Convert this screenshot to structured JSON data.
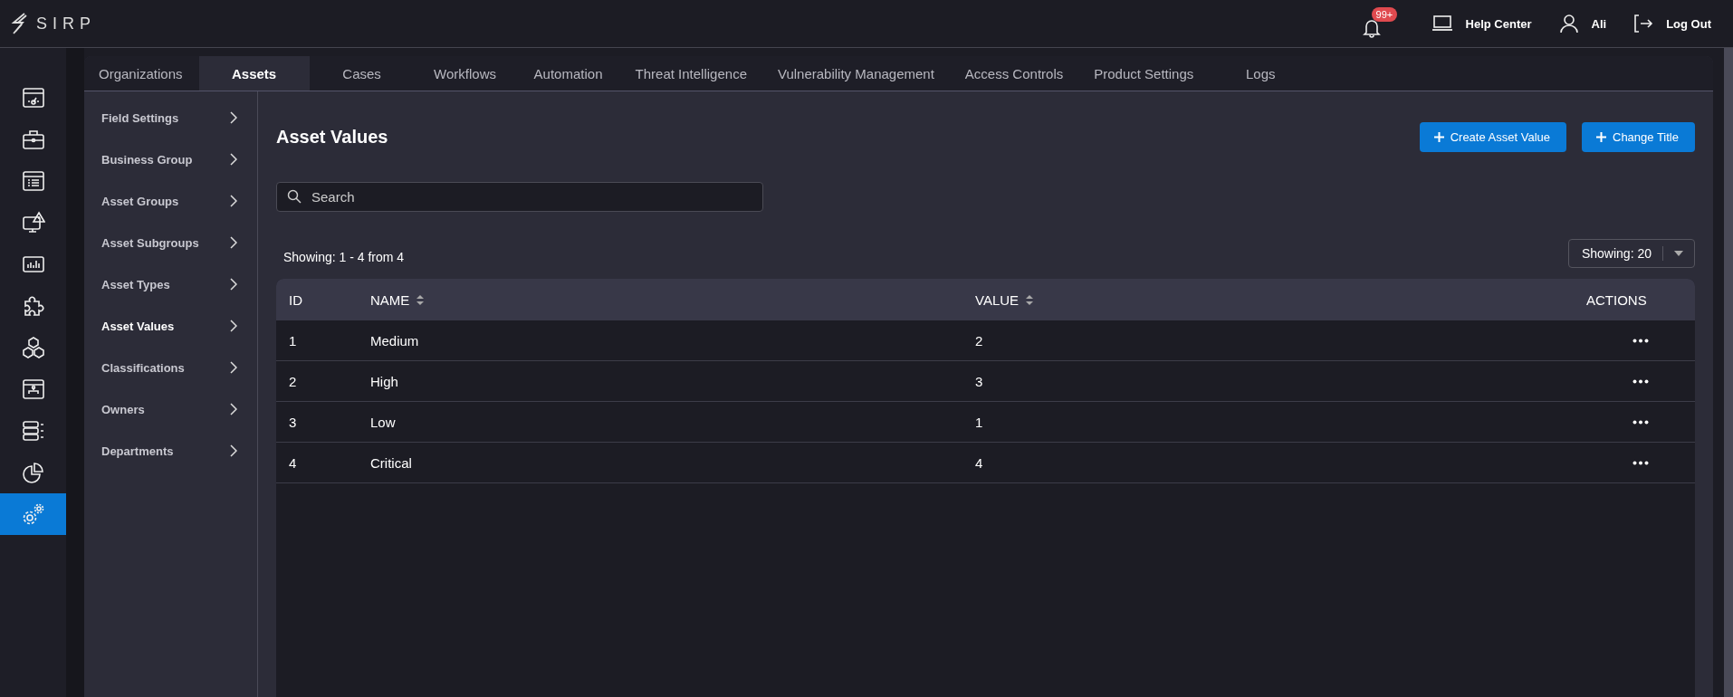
{
  "header": {
    "logo": "SIRP",
    "notifications": {
      "badge": "99+"
    },
    "links": [
      {
        "kind": "help",
        "label": "Help Center"
      },
      {
        "kind": "user",
        "label": "Ali"
      },
      {
        "kind": "logout",
        "label": "Log Out"
      }
    ]
  },
  "nav_rail": {
    "items": [
      {
        "selected": false
      },
      {
        "selected": false
      },
      {
        "selected": false
      },
      {
        "selected": false
      },
      {
        "selected": false
      },
      {
        "selected": false
      },
      {
        "selected": false
      },
      {
        "selected": false
      },
      {
        "selected": false
      },
      {
        "selected": false
      },
      {
        "selected": true
      }
    ]
  },
  "tabs": [
    {
      "label": "Organizations",
      "selected": false
    },
    {
      "label": "Assets",
      "selected": true
    },
    {
      "label": "Cases",
      "selected": false
    },
    {
      "label": "Workflows",
      "selected": false
    },
    {
      "label": "Automation",
      "selected": false
    },
    {
      "label": "Threat Intelligence",
      "selected": false
    },
    {
      "label": "Vulnerability Management",
      "selected": false
    },
    {
      "label": "Access Controls",
      "selected": false
    },
    {
      "label": "Product Settings",
      "selected": false
    },
    {
      "label": "Logs",
      "selected": false
    }
  ],
  "submenu": [
    {
      "label": "Field Settings",
      "selected": false
    },
    {
      "label": "Business Group",
      "selected": false
    },
    {
      "label": "Asset Groups",
      "selected": false
    },
    {
      "label": "Asset Subgroups",
      "selected": false
    },
    {
      "label": "Asset Types",
      "selected": false
    },
    {
      "label": "Asset Values",
      "selected": true
    },
    {
      "label": "Classifications",
      "selected": false
    },
    {
      "label": "Owners",
      "selected": false
    },
    {
      "label": "Departments",
      "selected": false
    }
  ],
  "page": {
    "title": "Asset Values",
    "buttons": [
      "Create Asset Value",
      "Change Title"
    ],
    "search": {
      "placeholder": "Search"
    },
    "summary": "Showing: 1 - 4 from 4",
    "page_size": "Showing: 20"
  },
  "table": {
    "columns": [
      {
        "label": "ID",
        "sortable": false
      },
      {
        "label": "NAME",
        "sortable": true
      },
      {
        "label": "VALUE",
        "sortable": true
      },
      {
        "label": "ACTIONS",
        "sortable": false
      }
    ],
    "rows": [
      {
        "id": "1",
        "name": "Medium",
        "value": "2"
      },
      {
        "id": "2",
        "name": "High",
        "value": "3"
      },
      {
        "id": "3",
        "name": "Low",
        "value": "1"
      },
      {
        "id": "4",
        "name": "Critical",
        "value": "4"
      }
    ]
  }
}
